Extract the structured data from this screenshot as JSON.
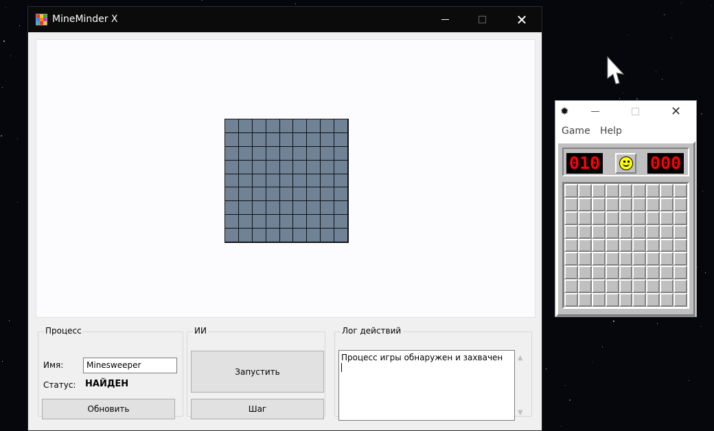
{
  "app": {
    "title": "MineMinder X",
    "controls": {
      "minimize": "minimize-icon",
      "maximize": "maximize-icon",
      "close": "close-icon"
    }
  },
  "board": {
    "rows": 9,
    "cols": 9,
    "cell_color": "#6f8296"
  },
  "process": {
    "group_title": "Процесс",
    "name_label": "Имя:",
    "name_value": "Minesweeper",
    "status_label": "Статус:",
    "status_value": "НАЙДЕН",
    "refresh_label": "Обновить"
  },
  "ai": {
    "group_title": "ИИ",
    "start_label": "Запустить",
    "step_label": "Шаг"
  },
  "log": {
    "group_title": "Лог действий",
    "text": "Процесс игры обнаружен и захвачен"
  },
  "minesweeper": {
    "menu": [
      "Game",
      "Help"
    ],
    "mine_counter": "010",
    "timer": "000",
    "rows": 9,
    "cols": 9,
    "icons": {
      "app": "mine-icon",
      "reset": "smiley-icon"
    }
  },
  "colors": {
    "led": "#ff0000",
    "tile": "#c0c0c0",
    "smiley": "#ffff00"
  }
}
